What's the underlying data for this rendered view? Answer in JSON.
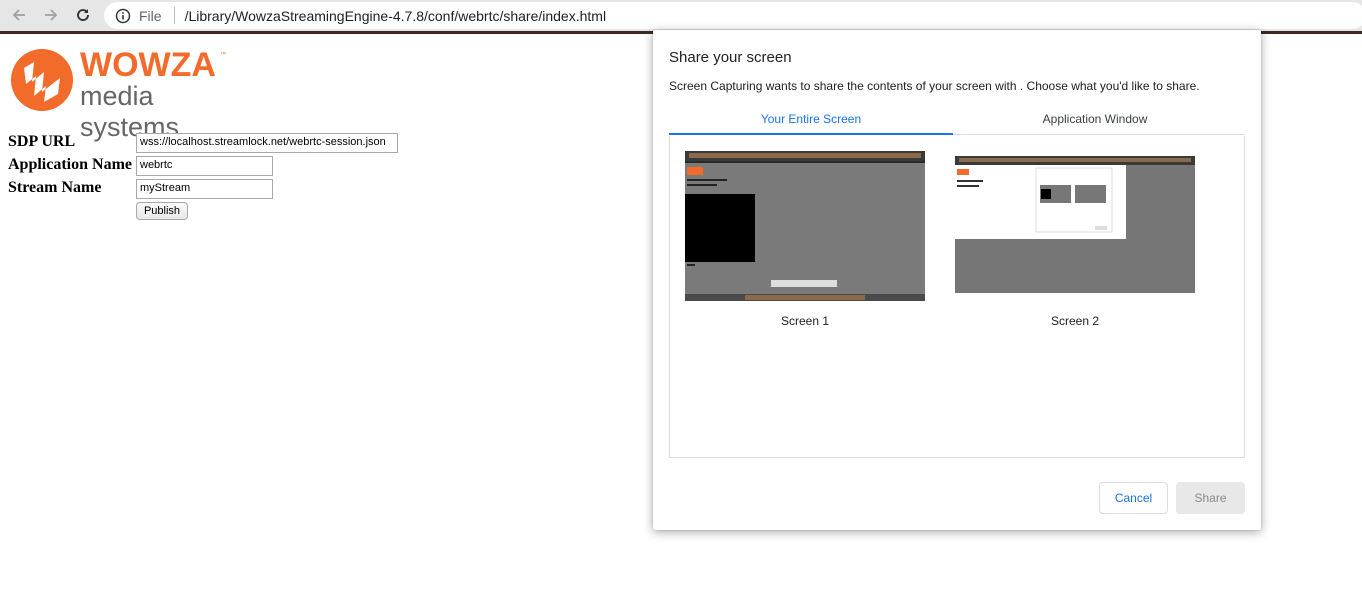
{
  "browser": {
    "scheme": "File",
    "url": "/Library/WowzaStreamingEngine-4.7.8/conf/webrtc/share/index.html"
  },
  "logo": {
    "word": "WOWZA",
    "tm": "™",
    "subtitle": "media systems"
  },
  "form": {
    "sdp_label": "SDP URL",
    "sdp_value": "wss://localhost.streamlock.net/webrtc-session.json",
    "app_label": "Application Name",
    "app_value": "webrtc",
    "stream_label": "Stream Name",
    "stream_value": "myStream",
    "publish_label": "Publish"
  },
  "dialog": {
    "title": "Share your screen",
    "description": "Screen Capturing wants to share the contents of your screen with . Choose what you'd like to share.",
    "tabs": [
      {
        "label": "Your Entire Screen",
        "active": true
      },
      {
        "label": "Application Window",
        "active": false
      }
    ],
    "screens": [
      {
        "label": "Screen 1"
      },
      {
        "label": "Screen 2"
      }
    ],
    "cancel_label": "Cancel",
    "share_label": "Share"
  },
  "colors": {
    "accent": "#1a73e8",
    "brand": "#f26b2a"
  }
}
